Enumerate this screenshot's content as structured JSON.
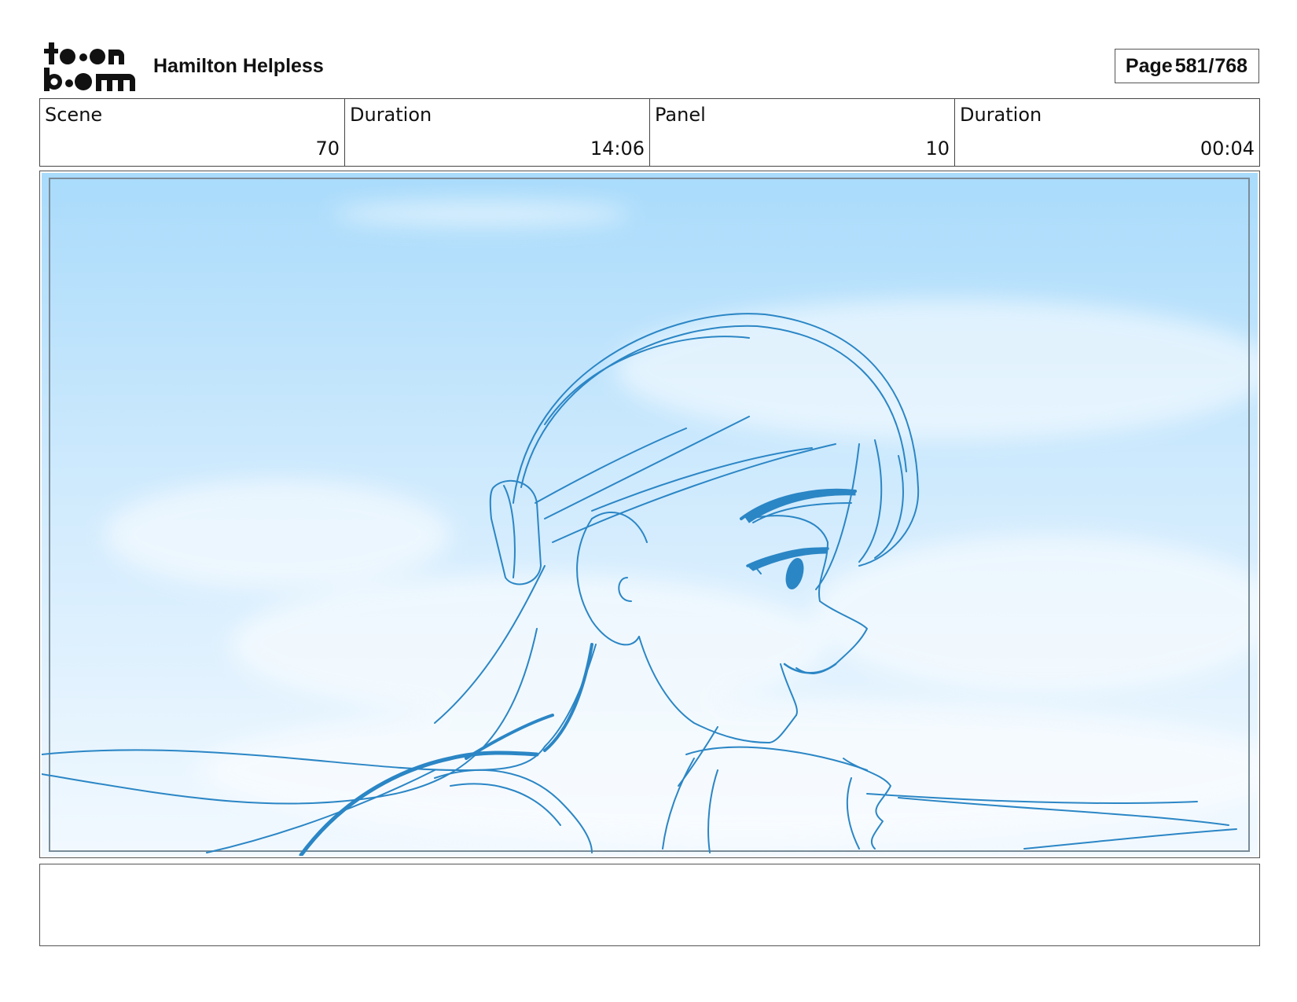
{
  "header": {
    "logo_text": "toon boom",
    "project_title": "Hamilton Helpless",
    "page_label": "Page",
    "page_current": "581",
    "page_total": "768"
  },
  "info": {
    "scene_label": "Scene",
    "scene_value": "70",
    "scene_duration_label": "Duration",
    "scene_duration_value": "14:06",
    "panel_label": "Panel",
    "panel_value": "10",
    "panel_duration_label": "Duration",
    "panel_duration_value": "00:04"
  },
  "panel": {
    "sky_top_color": "#a9dbfb",
    "sky_bottom_color": "#f2f9ff",
    "line_color": "#2b86c5"
  },
  "notes": {
    "text": ""
  }
}
